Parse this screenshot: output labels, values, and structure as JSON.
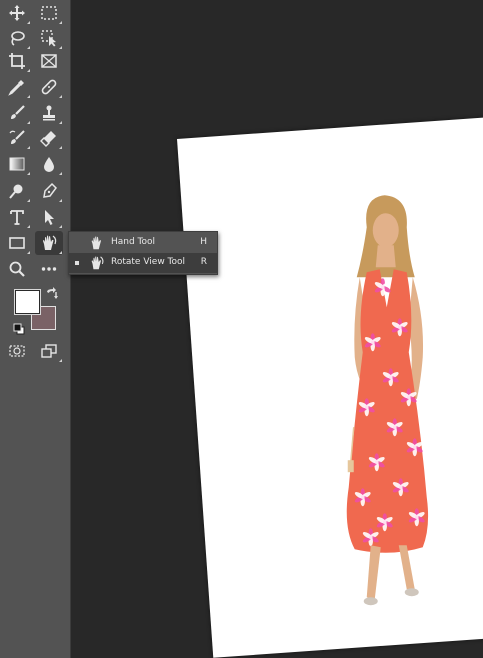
{
  "toolbar": {
    "tools": [
      {
        "name": "move-tool",
        "icon": "move-icon"
      },
      {
        "name": "rect-marquee-tool",
        "icon": "rect-marquee-icon"
      },
      {
        "name": "lasso-tool",
        "icon": "lasso-icon"
      },
      {
        "name": "object-selection-tool",
        "icon": "object-selection-icon"
      },
      {
        "name": "crop-tool",
        "icon": "crop-icon"
      },
      {
        "name": "frame-tool",
        "icon": "frame-icon"
      },
      {
        "name": "eyedropper-tool",
        "icon": "eyedropper-icon"
      },
      {
        "name": "healing-brush-tool",
        "icon": "bandage-icon"
      },
      {
        "name": "brush-tool",
        "icon": "brush-icon"
      },
      {
        "name": "clone-stamp-tool",
        "icon": "stamp-icon"
      },
      {
        "name": "history-brush-tool",
        "icon": "history-brush-icon"
      },
      {
        "name": "eraser-tool",
        "icon": "eraser-icon"
      },
      {
        "name": "gradient-tool",
        "icon": "gradient-icon"
      },
      {
        "name": "blur-tool",
        "icon": "drop-icon"
      },
      {
        "name": "dodge-tool",
        "icon": "dodge-icon"
      },
      {
        "name": "pen-tool",
        "icon": "pen-icon"
      },
      {
        "name": "type-tool",
        "icon": "type-icon"
      },
      {
        "name": "path-selection-tool",
        "icon": "arrow-icon"
      },
      {
        "name": "rectangle-tool",
        "icon": "rectangle-icon"
      },
      {
        "name": "rotate-view-tool",
        "icon": "rotate-hand-icon"
      },
      {
        "name": "zoom-tool",
        "icon": "magnifier-icon"
      },
      {
        "name": "edit-toolbar",
        "icon": "more-icon"
      }
    ],
    "colors": {
      "foreground": "#ffffff",
      "background": "#7a6266"
    },
    "mode_icons": [
      "quick-mask-icon",
      "screen-mode-icon"
    ]
  },
  "flyout": {
    "items": [
      {
        "label": "Hand Tool",
        "shortcut": "H",
        "selected": false,
        "icon": "hand-icon"
      },
      {
        "label": "Rotate View Tool",
        "shortcut": "R",
        "selected": true,
        "icon": "rotate-hand-icon"
      }
    ]
  },
  "canvas": {
    "rotation_deg": -4,
    "dress_color": "#f0694f",
    "flower_color": "#f04fa6"
  }
}
